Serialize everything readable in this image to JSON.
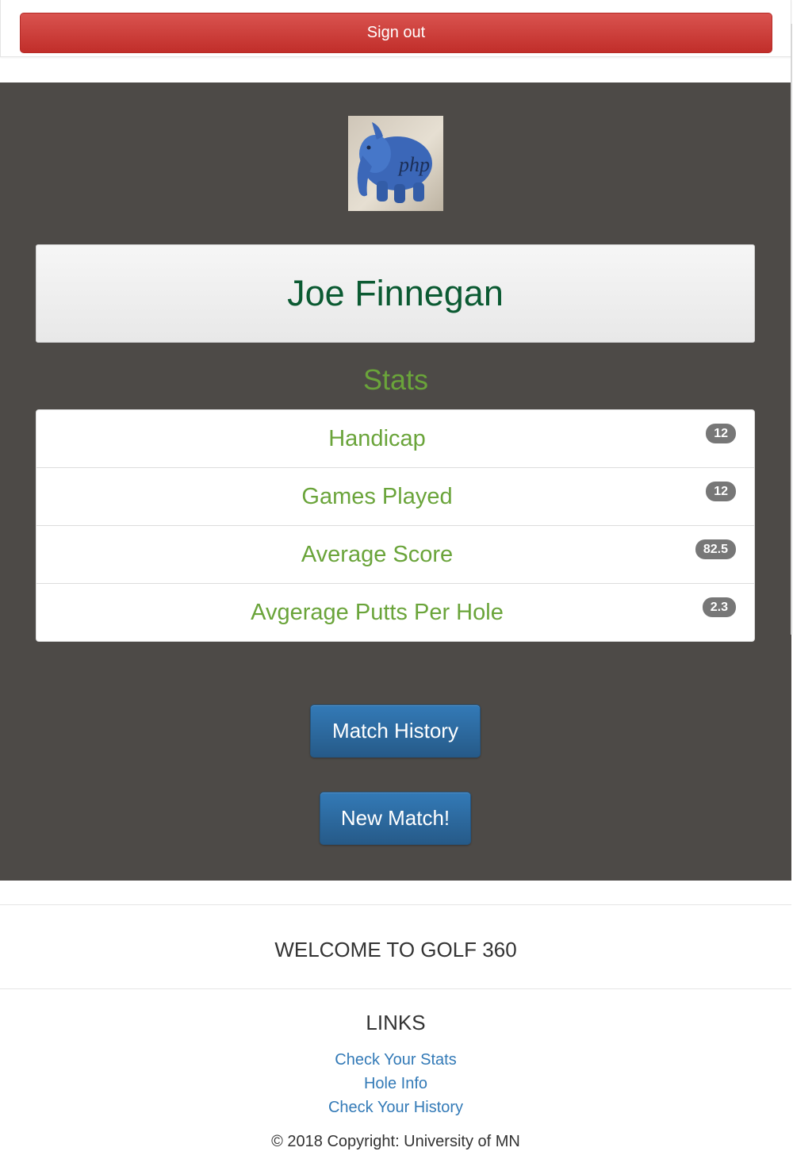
{
  "header": {
    "signout_label": "Sign out"
  },
  "profile": {
    "avatar_icon": "php-elephant-avatar",
    "avatar_text": "php",
    "name": "Joe Finnegan"
  },
  "stats": {
    "title": "Stats",
    "items": [
      {
        "label": "Handicap",
        "value": "12"
      },
      {
        "label": "Games Played",
        "value": "12"
      },
      {
        "label": "Average Score",
        "value": "82.5"
      },
      {
        "label": "Avgerage Putts Per Hole",
        "value": "2.3"
      }
    ]
  },
  "actions": {
    "match_history_label": "Match History",
    "new_match_label": "New Match!"
  },
  "footer": {
    "welcome": "WELCOME TO GOLF 360",
    "links_title": "LINKS",
    "links": [
      {
        "label": "Check Your Stats"
      },
      {
        "label": "Hole Info"
      },
      {
        "label": "Check Your History"
      }
    ],
    "copyright": "© 2018 Copyright: University of MN"
  },
  "colors": {
    "signout": "#d9534f",
    "hero_background": "#4d4a47",
    "name": "#0b5a32",
    "stat_text": "#6aa43a",
    "primary_button": "#337ab7",
    "link": "#337ab7",
    "badge": "#777777"
  }
}
